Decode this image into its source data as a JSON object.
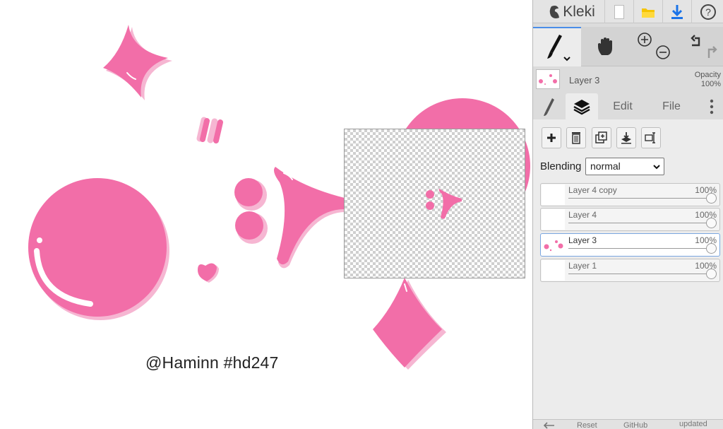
{
  "app": {
    "logo_text": "Kleki"
  },
  "colors": {
    "accent": "#4b8ee8",
    "paint_pink": "#f26ea8",
    "paint_light_pink": "#f6b6d2"
  },
  "topbar": {
    "icons": [
      "kleki-logo-icon",
      "new-file-icon",
      "open-folder-icon",
      "download-icon",
      "help-icon"
    ]
  },
  "tools": {
    "brush": "brush-icon",
    "hand": "hand-icon",
    "zoom_in": "zoom-in-icon",
    "zoom_out": "zoom-out-icon",
    "undo": "undo-icon",
    "redo": "redo-icon"
  },
  "current_layer": {
    "name": "Layer 3",
    "opacity_label": "Opacity",
    "opacity_value": "100%"
  },
  "tabs": {
    "edit": "Edit",
    "file": "File"
  },
  "layer_panel": {
    "buttons": [
      "add-layer-icon",
      "delete-layer-icon",
      "duplicate-layer-icon",
      "merge-down-icon",
      "rename-layer-icon"
    ],
    "blending_label": "Blending",
    "blending_value": "normal",
    "layers": [
      {
        "name": "Layer 4 copy",
        "opacity": "100%"
      },
      {
        "name": "Layer 4",
        "opacity": "100%"
      },
      {
        "name": "Layer 3",
        "opacity": "100%"
      },
      {
        "name": "Layer 1",
        "opacity": "100%"
      }
    ]
  },
  "canvas": {
    "signature": "@Haminn #hd247"
  },
  "bottombar": {
    "item1": "Reset",
    "item2": "GitHub",
    "item3": "updated"
  }
}
